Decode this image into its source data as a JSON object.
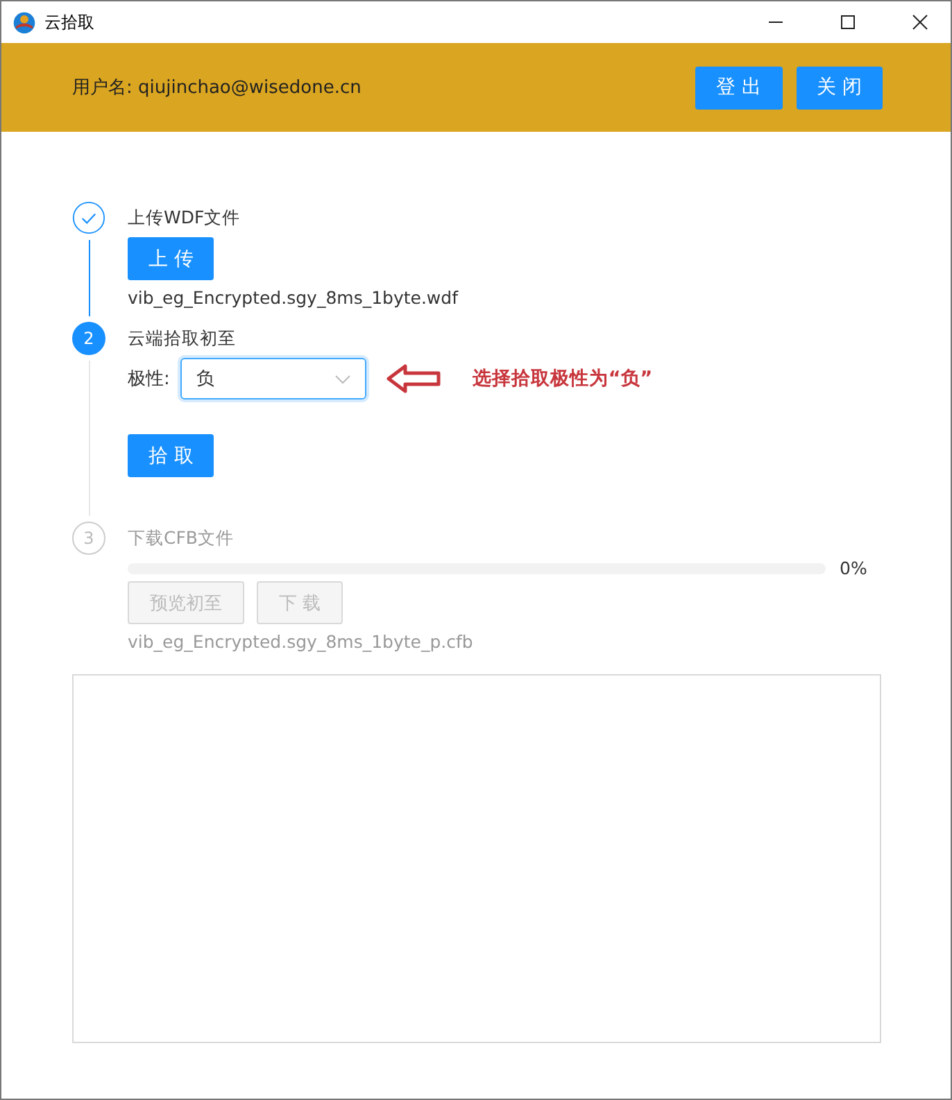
{
  "window": {
    "title": "云拾取"
  },
  "header": {
    "user_label": "用户名: qiujinchao@wisedone.cn",
    "buttons": [
      "登 出",
      "关 闭"
    ]
  },
  "steps": [
    {
      "kind": "upload",
      "done": true,
      "title": "上传WDF文件",
      "button": {
        "label": "上 传",
        "disabled": false
      },
      "file": "vib_eg_Encrypted.sgy_8ms_1byte.wdf"
    },
    {
      "kind": "extract",
      "done": false,
      "active": true,
      "number": "2",
      "title": "云端拾取初至",
      "field_label": "极性:",
      "select_value": "负",
      "button": {
        "label": "拾 取",
        "disabled": false
      },
      "annotation": "选择拾取极性为“负”"
    },
    {
      "kind": "download",
      "done": false,
      "active": false,
      "number": "3",
      "title": "下载CFB文件",
      "progress": {
        "level": 0,
        "reading": "0%"
      },
      "buttons": [
        {
          "label": "预览初至",
          "disabled": true
        },
        {
          "label": "下 载",
          "disabled": true
        }
      ],
      "file": "vib_eg_Encrypted.sgy_8ms_1byte_p.cfb"
    }
  ],
  "output_panel": {
    "kind": "empty"
  }
}
